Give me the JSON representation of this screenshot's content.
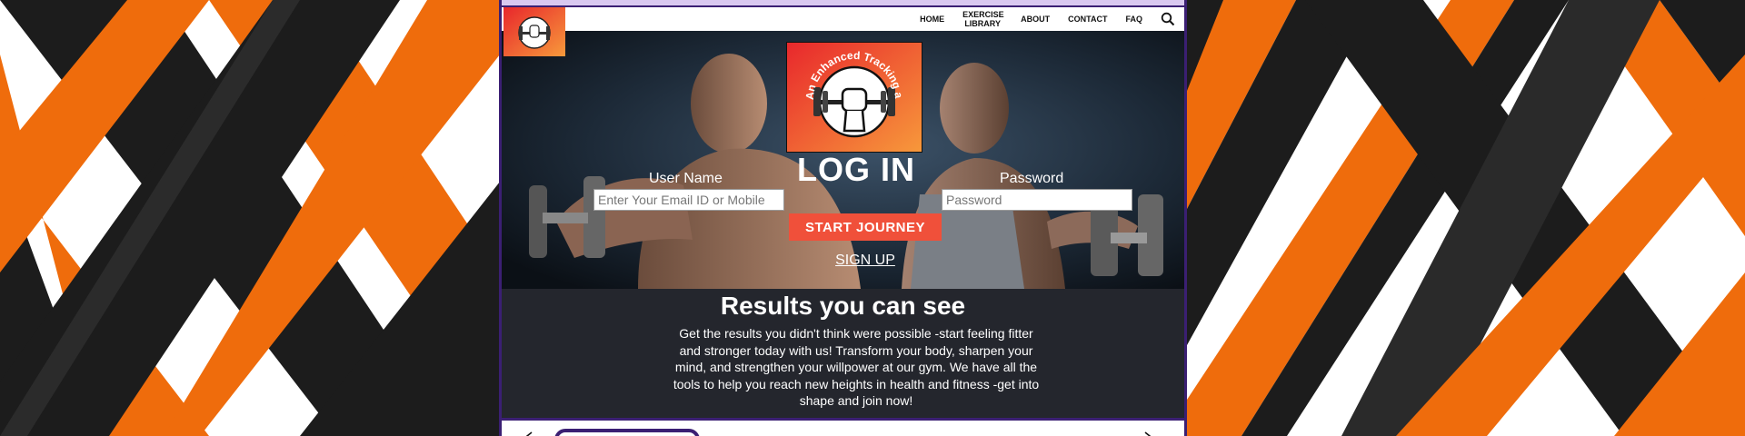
{
  "nav": {
    "links": [
      {
        "label": "HOME"
      },
      {
        "label": "EXERCISE LIBRARY"
      },
      {
        "label": "ABOUT"
      },
      {
        "label": "CONTACT"
      },
      {
        "label": "FAQ"
      }
    ],
    "search_icon": "search-icon"
  },
  "logo": {
    "text": "An Enhanced Tracking and Safety",
    "icon": "fist-dumbbell-icon",
    "gradient_colors": [
      "#e8272c",
      "#f7993b"
    ]
  },
  "login": {
    "title": "LOG IN",
    "username_label": "User Name",
    "username_placeholder": "Enter Your Email ID or Mobile",
    "password_label": "Password",
    "password_placeholder": "Password",
    "submit_label": "START JOURNEY",
    "signup_label": "SIGN UP"
  },
  "results": {
    "title": "Results you can see",
    "body": "Get the results you didn't think were possible -start feeling fitter and stronger today with us! Transform your body, sharpen your mind, and strengthen your willpower at our gym. We have all the tools to help you reach new heights in health and fitness -get into shape and join now!"
  },
  "carousel": {
    "prev_icon": "chevron-left-icon",
    "next_icon": "chevron-right-icon"
  },
  "colors": {
    "accent_orange": "#ef6c0c",
    "dark": "#1c1c1c",
    "frame_purple": "#3b1f73",
    "button": "#f0503a",
    "results_bg": "#24262d"
  }
}
